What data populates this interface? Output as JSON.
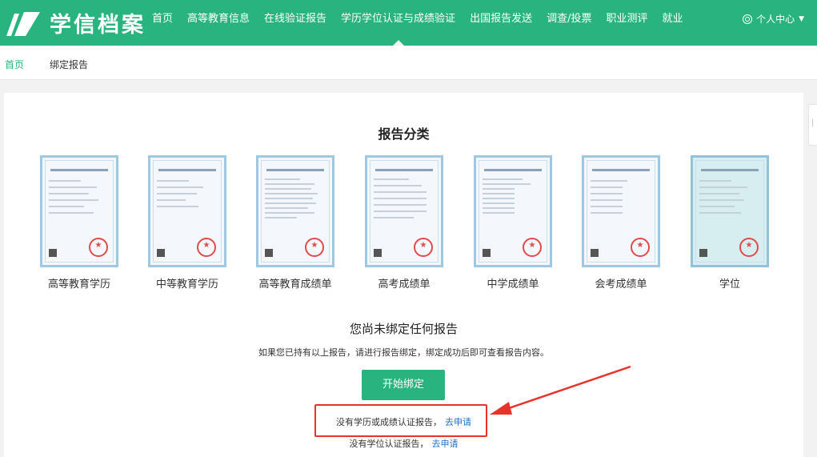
{
  "header": {
    "brand": "学信档案",
    "nav": [
      {
        "label": "首页",
        "active": false
      },
      {
        "label": "高等教育信息",
        "active": false
      },
      {
        "label": "在线验证报告",
        "active": false
      },
      {
        "label": "学历学位认证与成绩验证",
        "active": true
      },
      {
        "label": "出国报告发送",
        "active": false
      },
      {
        "label": "调查/投票",
        "active": false
      },
      {
        "label": "职业测评",
        "active": false
      },
      {
        "label": "就业",
        "active": false
      }
    ],
    "user_menu": "个人中心",
    "accent_color": "#29b47f"
  },
  "breadcrumb": {
    "home": "首页",
    "current": "绑定报告"
  },
  "main": {
    "section_title": "报告分类",
    "categories": [
      {
        "label": "高等教育学历",
        "icon": "certificate-icon"
      },
      {
        "label": "中等教育学历",
        "icon": "certificate-icon"
      },
      {
        "label": "高等教育成绩单",
        "icon": "certificate-icon"
      },
      {
        "label": "高考成绩单",
        "icon": "certificate-icon"
      },
      {
        "label": "中学成绩单",
        "icon": "certificate-icon"
      },
      {
        "label": "会考成绩单",
        "icon": "certificate-icon"
      },
      {
        "label": "学位",
        "icon": "certificate-icon"
      }
    ],
    "empty_title": "您尚未绑定任何报告",
    "empty_desc": "如果您已持有以上报告，请进行报告绑定，绑定成功后即可查看报告内容。",
    "bind_button": "开始绑定",
    "apply_education": {
      "text": "没有学历或成绩认证报告，",
      "link": "去申请"
    },
    "apply_degree": {
      "text": "没有学位认证报告，",
      "link": "去申请"
    },
    "annotation_color": "#e8332a"
  }
}
